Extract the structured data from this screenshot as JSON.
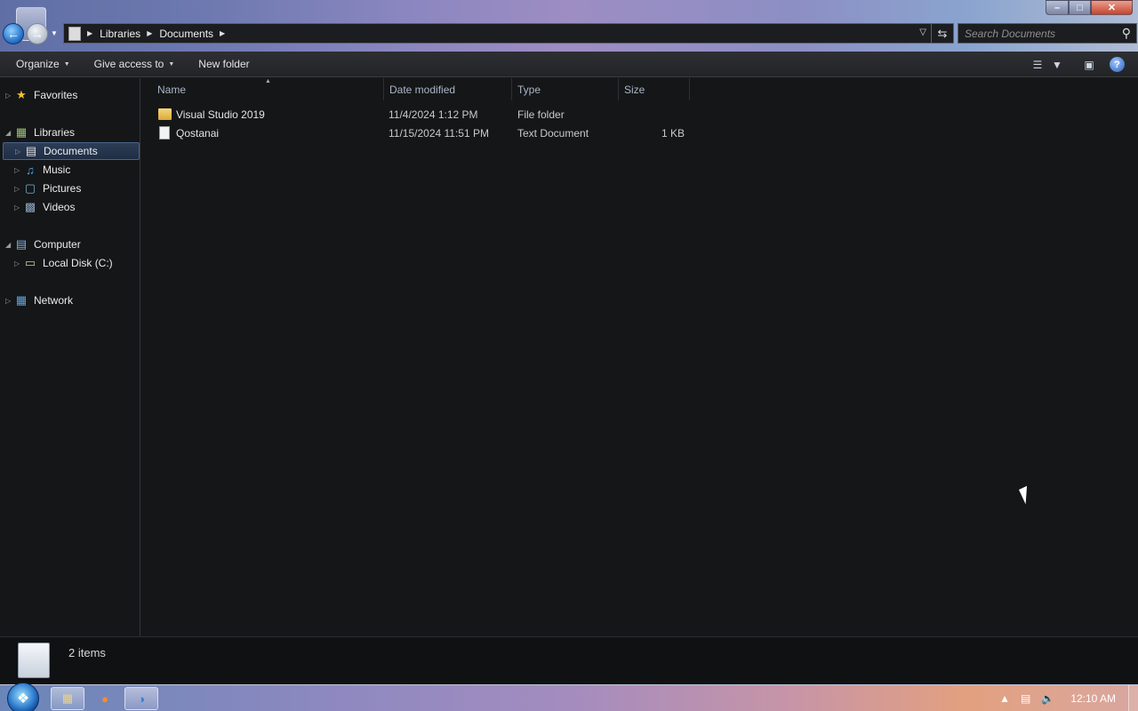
{
  "window": {
    "address": {
      "crumbs": [
        "Libraries",
        "Documents"
      ]
    },
    "search": {
      "placeholder": "Search Documents"
    },
    "controls": {
      "minimize": "–",
      "maximize": "□",
      "close": "✕"
    }
  },
  "toolbar": {
    "organize": "Organize",
    "give_access": "Give access to",
    "new_folder": "New folder"
  },
  "sidebar": {
    "favorites": "Favorites",
    "libraries": "Libraries",
    "documents": "Documents",
    "music": "Music",
    "pictures": "Pictures",
    "videos": "Videos",
    "computer": "Computer",
    "local_disk": "Local Disk (C:)",
    "network": "Network"
  },
  "columns": {
    "name": "Name",
    "date": "Date modified",
    "type": "Type",
    "size": "Size"
  },
  "files": [
    {
      "name": "Visual Studio 2019",
      "date": "11/4/2024 1:12 PM",
      "type": "File folder",
      "size": "",
      "icon": "folder-icon"
    },
    {
      "name": "Qostanai",
      "date": "11/15/2024 11:51 PM",
      "type": "Text Document",
      "size": "1 KB",
      "icon": "text-document-icon"
    }
  ],
  "status": {
    "count": "2 items"
  },
  "taskbar": {
    "clock": "12:10 AM"
  },
  "colors": {
    "title_gradient_start": "#5f6fa5",
    "window_bg": "#151617",
    "selected_nav": "#2c3d55",
    "taskbar_accent": "#e3a07f"
  }
}
